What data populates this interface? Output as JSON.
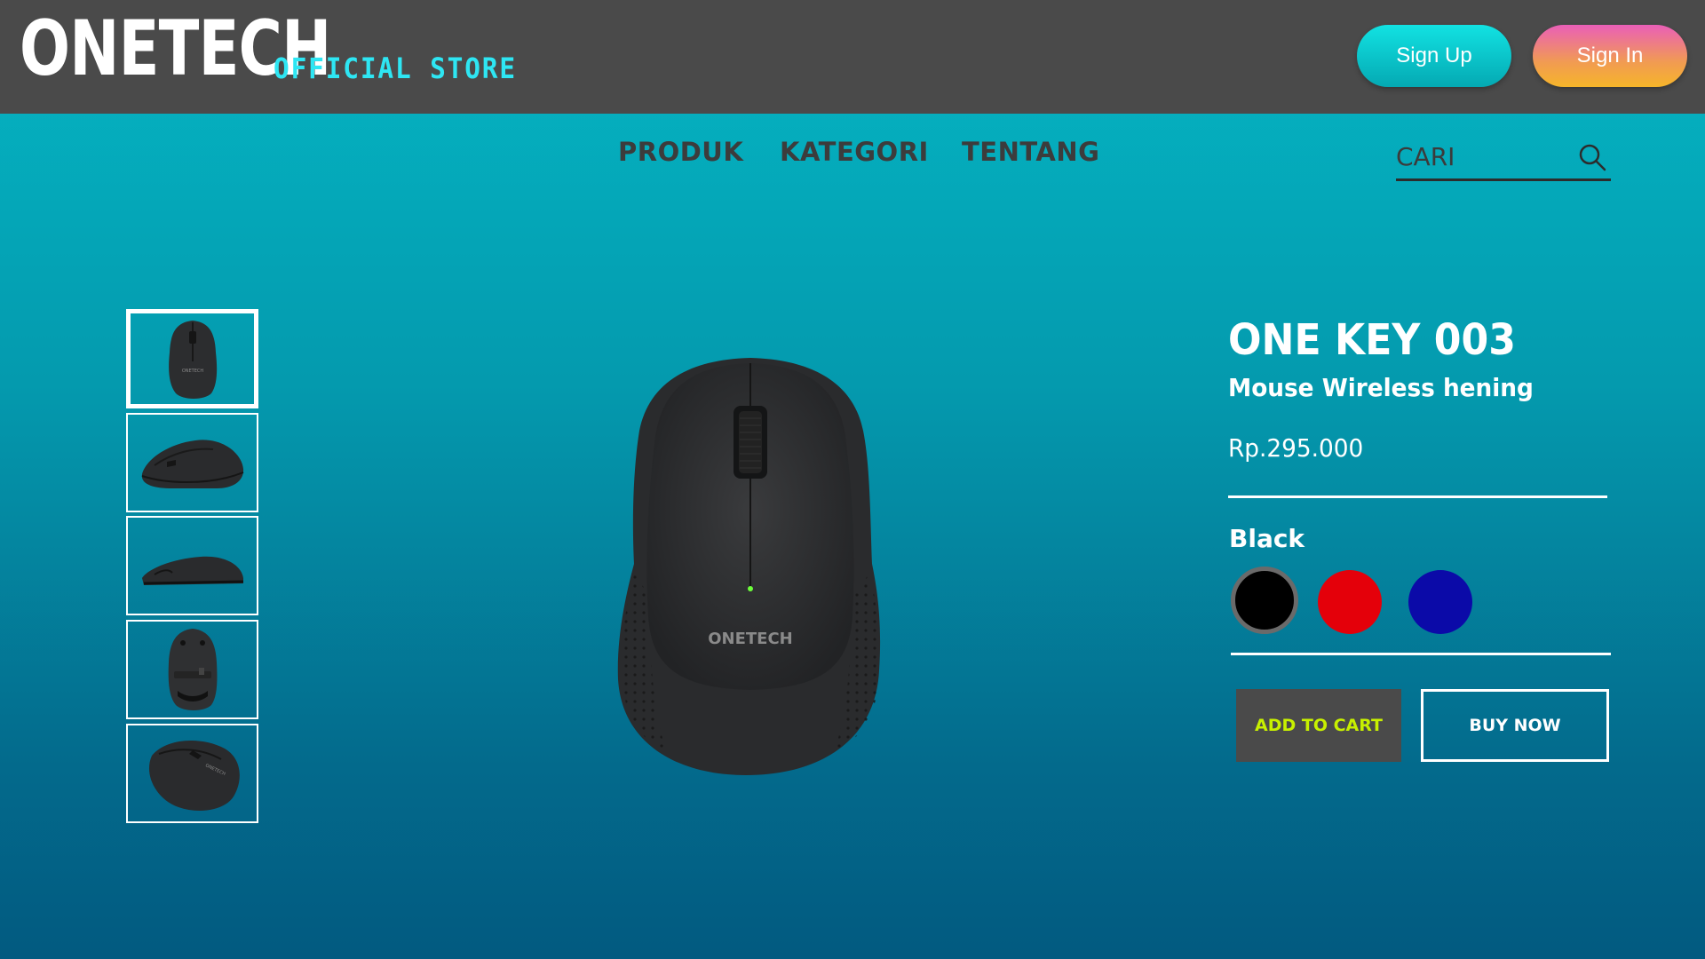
{
  "header": {
    "logo": "ONETECH",
    "store_tag": "OFFICIAL STORE",
    "signup_label": "Sign Up",
    "signin_label": "Sign In"
  },
  "nav": {
    "items": [
      {
        "label": "PRODUK"
      },
      {
        "label": "KATEGORI"
      },
      {
        "label": "TENTANG"
      }
    ],
    "search_placeholder": "CARI"
  },
  "product": {
    "name": "ONE KEY 003",
    "subtitle": "Mouse Wireless hening",
    "price": "Rp.295.000",
    "selected_color": "Black",
    "colors": [
      {
        "name": "Black",
        "hex": "#000000"
      },
      {
        "name": "Red",
        "hex": "#e4000a"
      },
      {
        "name": "Blue",
        "hex": "#0b0aa8"
      }
    ],
    "image_brand": "ONETECH",
    "thumbnail_views": [
      "top",
      "angled-left",
      "side",
      "bottom",
      "angled-right"
    ],
    "add_to_cart_label": "ADD TO CART",
    "buy_now_label": "BUY NOW"
  },
  "colors": {
    "header_bg": "#4a4a4a",
    "accent_cyan": "#2ee6f3",
    "cart_text": "#c8f000"
  }
}
